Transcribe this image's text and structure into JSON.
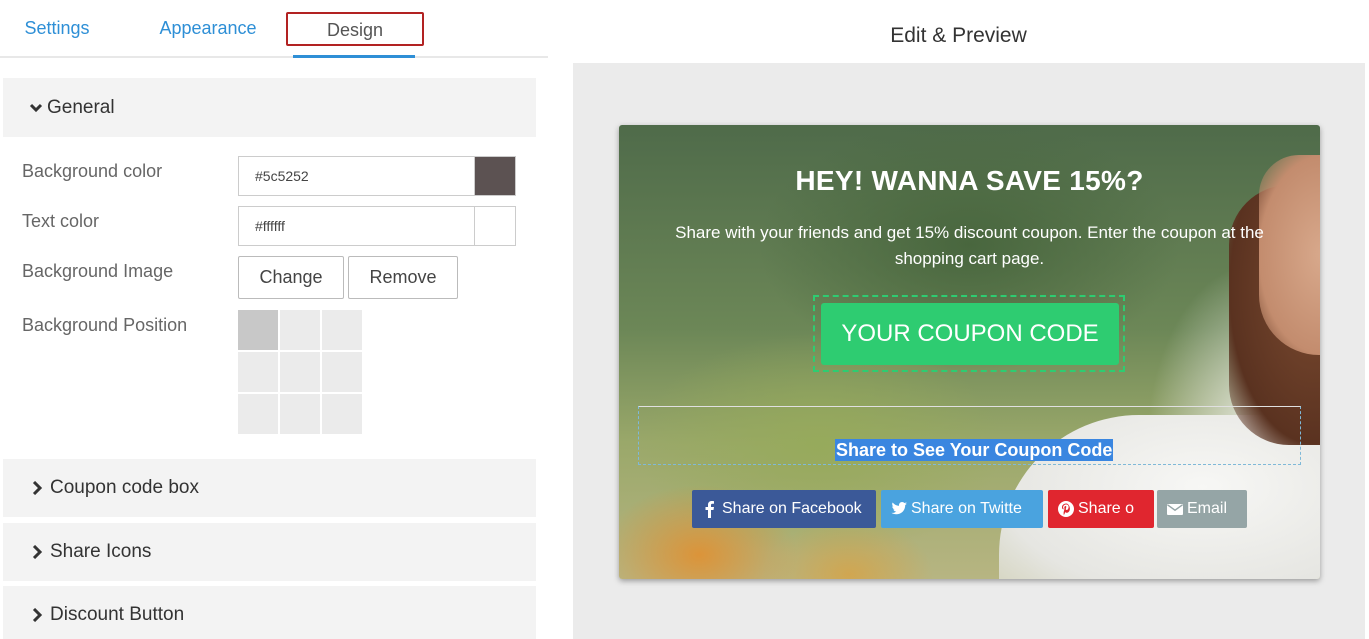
{
  "tabs": {
    "settings": "Settings",
    "appearance": "Appearance",
    "design": "Design"
  },
  "sections": {
    "general": "General",
    "coupon_code_box": "Coupon code box",
    "share_icons": "Share Icons",
    "discount_button": "Discount Button"
  },
  "general": {
    "background_color_label": "Background color",
    "background_color_value": "#5c5252",
    "text_color_label": "Text color",
    "text_color_value": "#ffffff",
    "background_image_label": "Background Image",
    "change_label": "Change",
    "remove_label": "Remove",
    "background_position_label": "Background Position",
    "selected_position": "top-left"
  },
  "preview": {
    "title": "Edit & Preview",
    "headline": "HEY! WANNA SAVE 15%?",
    "subtext": "Share with your friends and get 15% discount coupon. Enter the coupon at the shopping cart page.",
    "coupon_label": "YOUR COUPON CODE",
    "share_prompt": "Share to See Your Coupon Code",
    "share_buttons": {
      "facebook": "Share on Facebook",
      "twitter": "Share on Twitte",
      "pinterest": "Share o",
      "email": "Email"
    }
  },
  "colors": {
    "accent_blue": "#2e8fd6",
    "active_tab_border": "#b22222",
    "coupon_green": "#2ecc71",
    "facebook": "#3b5998",
    "twitter": "#4aa3df",
    "pinterest": "#e0262f",
    "email": "#95a5a6",
    "bg_swatch": "#5c5252",
    "text_swatch": "#ffffff"
  },
  "icons": {
    "expanded": "chevron-down-icon",
    "collapsed": "chevron-right-icon",
    "facebook": "facebook-icon",
    "twitter": "twitter-icon",
    "pinterest": "pinterest-icon",
    "email": "envelope-icon"
  }
}
